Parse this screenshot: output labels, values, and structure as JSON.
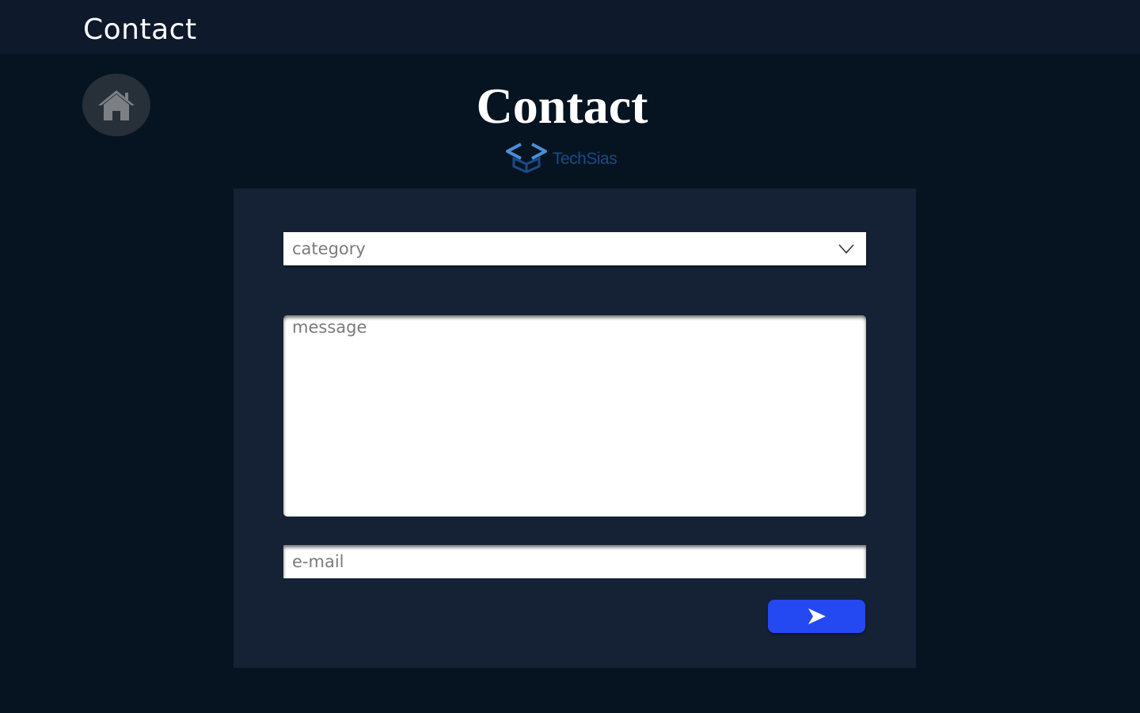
{
  "header": {
    "title": "Contact"
  },
  "nav": {
    "home_icon": "home-icon"
  },
  "main": {
    "title": "Contact",
    "logo_text": "TechSias"
  },
  "form": {
    "category_placeholder": "category",
    "message_placeholder": "message",
    "email_placeholder": "e-mail",
    "send_icon": "send-arrow-icon"
  },
  "colors": {
    "background": "#061421",
    "header": "#0e1a2c",
    "card": "#152235",
    "accent": "#2448f2",
    "logo_blue": "#1b4a86"
  }
}
